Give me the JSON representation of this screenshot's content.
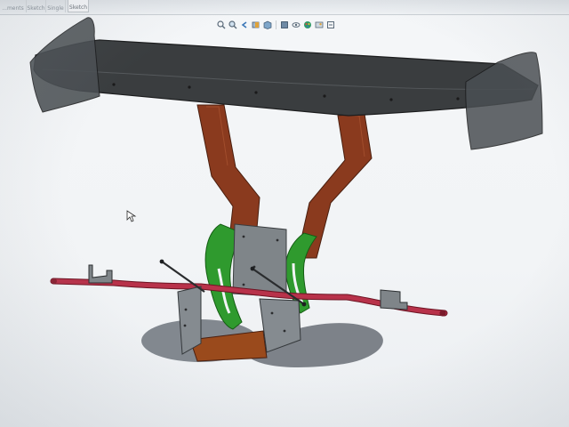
{
  "ribbon": {
    "tabs": [
      {
        "label": "...ments"
      },
      {
        "label": "Sketch"
      },
      {
        "label": "Single"
      },
      {
        "label": "Sketch"
      }
    ]
  },
  "view_toolbar": {
    "icons": [
      "zoom-to-fit-icon",
      "zoom-area-icon",
      "previous-view-icon",
      "section-view-icon",
      "view-orientation-icon",
      "display-style-icon",
      "hide-show-icon",
      "edit-appearance-icon",
      "apply-scene-icon",
      "view-settings-icon"
    ]
  },
  "model": {
    "colors": {
      "wing": "#3a3d3f",
      "endplate": "#4a4f53",
      "strut": "#8a3a1e",
      "bracket": "#2f9a2e",
      "plate": "#7f8589",
      "tube": "#b8324a",
      "base": "#9a4a1c",
      "shadow": "#6f757c"
    }
  }
}
